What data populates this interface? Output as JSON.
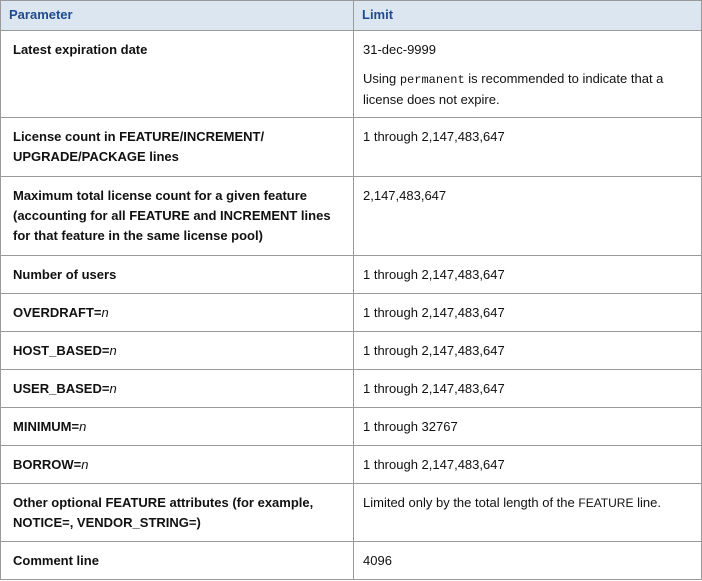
{
  "headers": {
    "parameter": "Parameter",
    "limit": "Limit"
  },
  "rows": [
    {
      "param": "Latest expiration date",
      "limit": "31-dec-9999",
      "note": {
        "pre": "Using ",
        "code": "permanent",
        "post": " is recommended to indicate that a license does not expire."
      }
    },
    {
      "param": "License count in FEATURE/INCREMENT/ UPGRADE/PACKAGE lines",
      "limit": "1 through 2,147,483,647"
    },
    {
      "param": "Maximum total license count for a given feature (accounting for all FEATURE and INCREMENT lines for that feature in the same license pool)",
      "limit": "2,147,483,647"
    },
    {
      "param": "Number of users",
      "limit": "1 through 2,147,483,647"
    },
    {
      "param": "OVERDRAFT=",
      "var": "n",
      "limit": "1 through 2,147,483,647"
    },
    {
      "param": "HOST_BASED=",
      "var": "n",
      "limit": "1 through 2,147,483,647"
    },
    {
      "param": "USER_BASED=",
      "var": "n",
      "limit": "1 through 2,147,483,647"
    },
    {
      "param": "MINIMUM=",
      "var": "n",
      "limit": "1 through 32767"
    },
    {
      "param": "BORROW=",
      "var": "n",
      "limit": "1 through 2,147,483,647"
    },
    {
      "param": "Other optional FEATURE attributes (for example, NOTICE=, VENDOR_STRING=)",
      "limit_parts": {
        "pre": "Limited only by the total length of the ",
        "code": "FEATURE",
        "post": " line."
      }
    },
    {
      "param": "Comment line",
      "limit": "4096"
    }
  ]
}
